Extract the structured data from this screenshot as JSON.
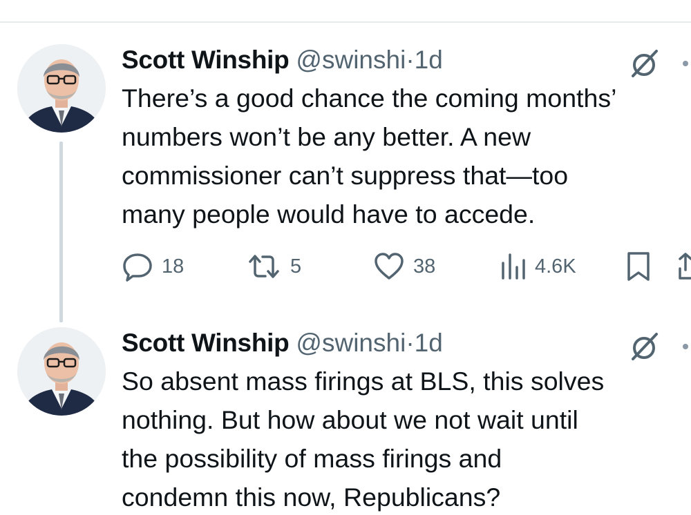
{
  "tweets": [
    {
      "author_name": "Scott Winship",
      "handle": "@swinshi",
      "separator": "·",
      "time": "1d",
      "text_lines": [
        "There’s a good chance the coming months’",
        "numbers won’t be any better. A new",
        "commissioner can’t suppress that—too",
        "many people would have to accede."
      ],
      "actions": {
        "replies": "18",
        "reposts": "5",
        "likes": "38",
        "views": "4.6K"
      }
    },
    {
      "author_name": "Scott Winship",
      "handle": "@swinshi",
      "separator": "·",
      "time": "1d",
      "text_lines": [
        "So absent mass firings at BLS, this solves",
        "nothing. But how about we not wait until",
        "the possibility of mass firings and",
        "condemn this now, Republicans?"
      ]
    }
  ],
  "icons": {
    "reply": "reply-icon",
    "repost": "repost-icon",
    "like": "heart-icon",
    "views": "views-icon",
    "bookmark": "bookmark-icon",
    "share": "share-icon",
    "grok": "grok-icon",
    "more": "more-icon"
  },
  "colors": {
    "text": "#0f1419",
    "secondary": "#536471",
    "thread_line": "#cfd9de"
  }
}
